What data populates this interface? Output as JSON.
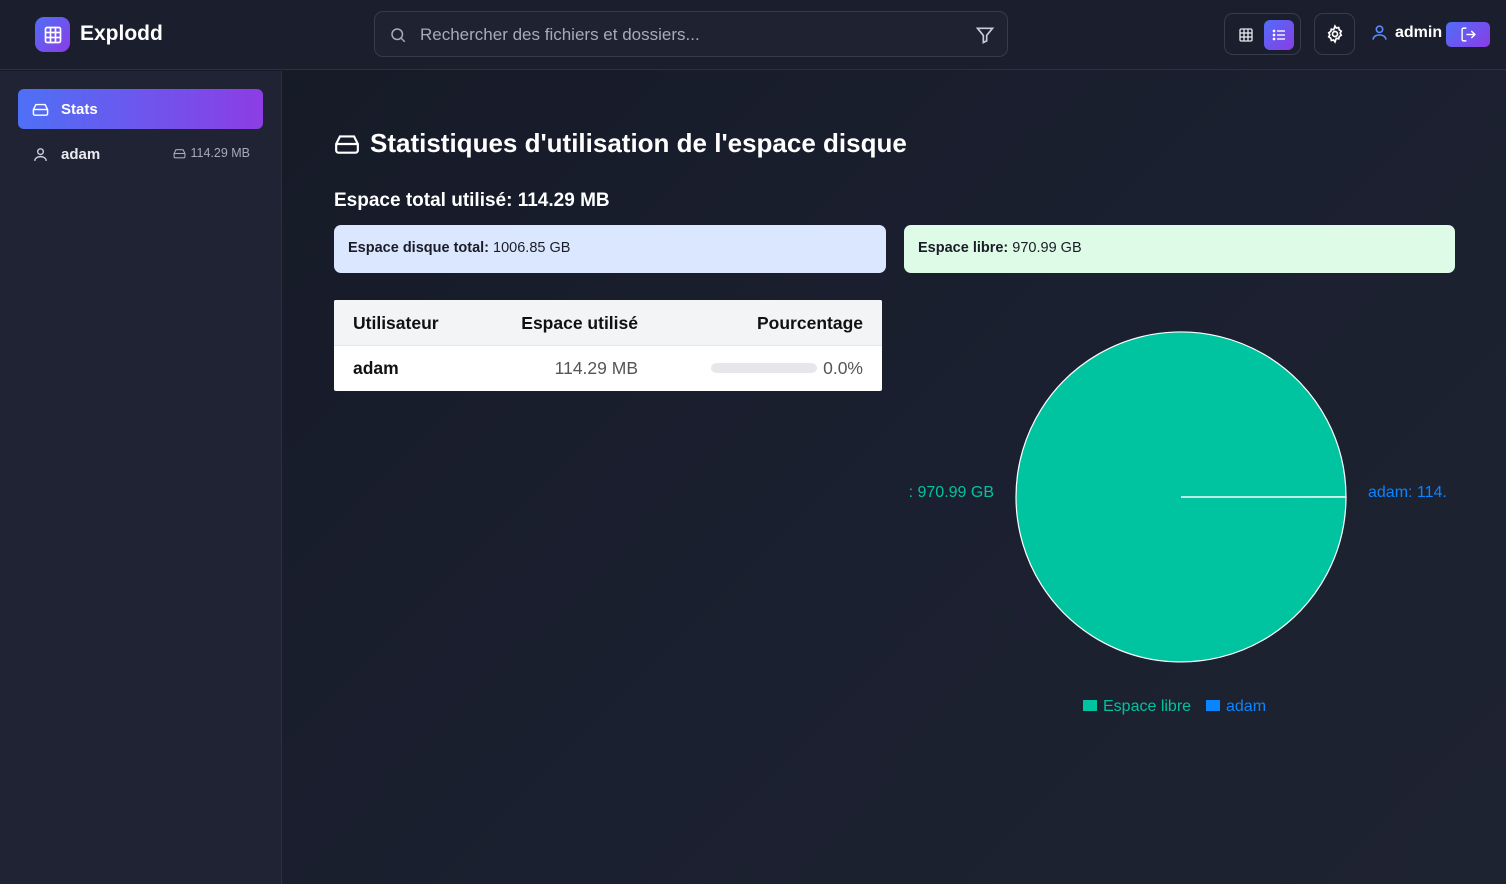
{
  "app": {
    "name": "Explodd"
  },
  "search": {
    "placeholder": "Rechercher des fichiers et dossiers..."
  },
  "header": {
    "username": "admin"
  },
  "sidebar": {
    "items": [
      {
        "label": "Stats",
        "icon": "hard-drive-icon",
        "active": true
      },
      {
        "label": "adam",
        "icon": "user-icon",
        "size": "114.29 MB"
      }
    ]
  },
  "main": {
    "title": "Statistiques d'utilisation de l'espace disque",
    "total_used": "Espace total utilisé: 114.29 MB",
    "cards": {
      "total_label": "Espace disque total:",
      "total_value": " 1006.85 GB",
      "free_label": "Espace libre:",
      "free_value": " 970.99 GB"
    },
    "table": {
      "headers": [
        "Utilisateur",
        "Espace utilisé",
        "Pourcentage"
      ],
      "rows": [
        {
          "user": "adam",
          "used": "114.29 MB",
          "percent": "0.0%",
          "percent_value": 0.0
        }
      ]
    }
  },
  "colors": {
    "accent_start": "#4f6ef7",
    "accent_end": "#8b3ce6",
    "free": "#00c3a0",
    "user": "#0a84ff"
  },
  "chart_data": {
    "type": "pie",
    "series": [
      {
        "name": "Espace libre",
        "value": 970.99,
        "label": ": 970.99 GB",
        "color": "#00c3a0"
      },
      {
        "name": "adam",
        "value": 0.11,
        "label": "adam: 114.",
        "color": "#0a84ff"
      }
    ],
    "legend": [
      "Espace libre",
      "adam"
    ],
    "legend_position": "bottom"
  }
}
